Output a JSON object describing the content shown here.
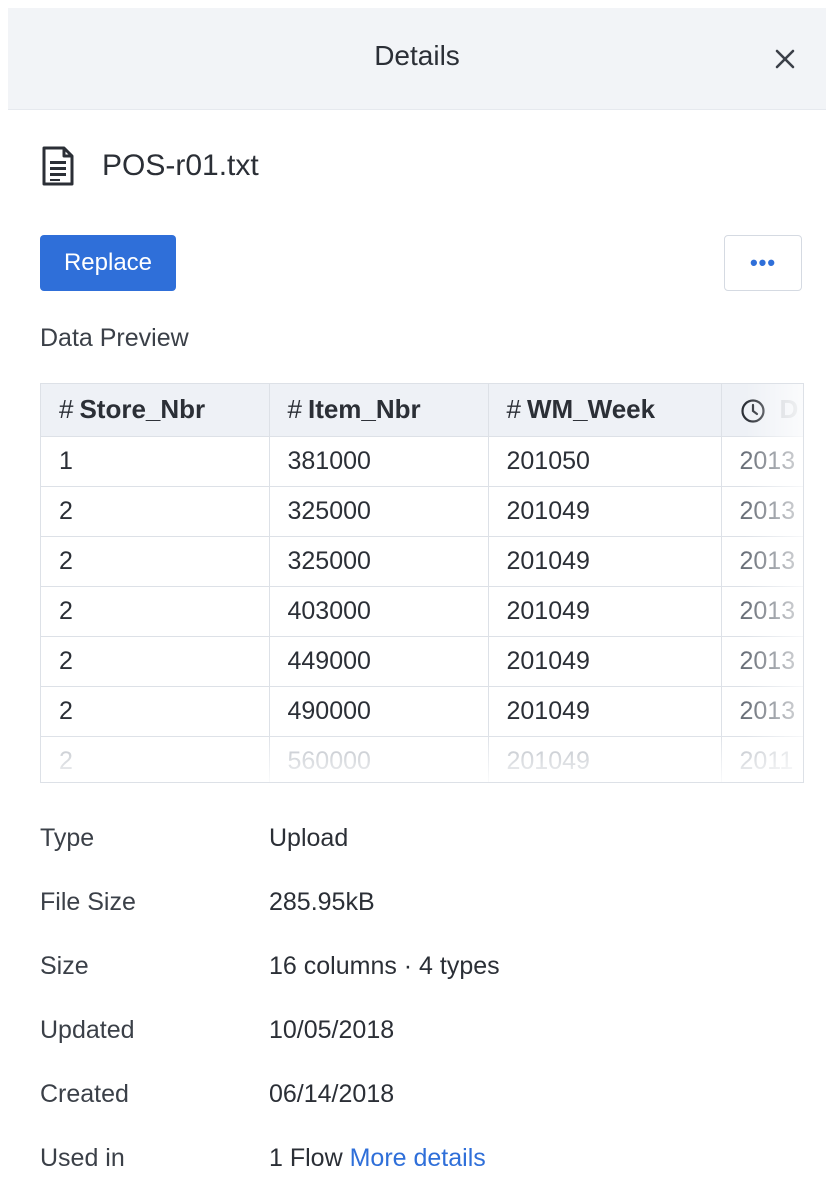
{
  "header": {
    "title": "Details"
  },
  "file": {
    "name": "POS-r01.txt",
    "icon": "document-icon"
  },
  "actions": {
    "replace_label": "Replace",
    "more_label": "•••"
  },
  "preview": {
    "label": "Data Preview",
    "columns": [
      {
        "type_symbol": "#",
        "name": "Store_Nbr"
      },
      {
        "type_symbol": "#",
        "name": "Item_Nbr"
      },
      {
        "type_symbol": "#",
        "name": "WM_Week"
      },
      {
        "type_symbol": "clock-icon",
        "name": "D"
      }
    ],
    "rows": [
      [
        "1",
        "381000",
        "201050",
        "2013"
      ],
      [
        "2",
        "325000",
        "201049",
        "2013"
      ],
      [
        "2",
        "325000",
        "201049",
        "2013"
      ],
      [
        "2",
        "403000",
        "201049",
        "2013"
      ],
      [
        "2",
        "449000",
        "201049",
        "2013"
      ],
      [
        "2",
        "490000",
        "201049",
        "2013"
      ],
      [
        "2",
        "560000",
        "201049",
        "2011"
      ]
    ]
  },
  "meta": [
    {
      "key": "Type",
      "value": "Upload"
    },
    {
      "key": "File Size",
      "value": "285.95kB"
    },
    {
      "key": "Size",
      "value": "16 columns · 4 types"
    },
    {
      "key": "Updated",
      "value": "10/05/2018"
    },
    {
      "key": "Created",
      "value": "06/14/2018"
    },
    {
      "key": "Used in",
      "value": "1 Flow",
      "link": "More details"
    }
  ],
  "colors": {
    "accent": "#2f6fd9",
    "header_bg": "#f2f4f7",
    "table_header_bg": "#eef1f6"
  }
}
